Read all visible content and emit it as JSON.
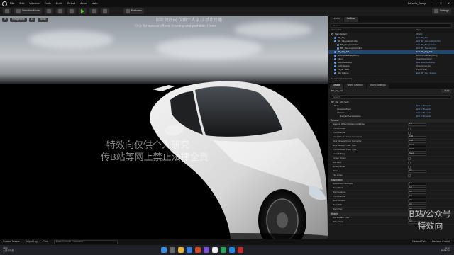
{
  "menubar": {
    "items": [
      "File",
      "Edit",
      "Window",
      "Tools",
      "Build",
      "Select",
      "Actor",
      "Help"
    ],
    "project": "Disable_Jump",
    "window_controls": [
      "—",
      "□",
      "✕"
    ]
  },
  "toolbar": {
    "mode_label": "Selection Mode",
    "platforms_label": "Platforms",
    "settings_label": "Settings"
  },
  "viewport": {
    "perspective_label": "Perspective",
    "lit_label": "Lit",
    "show_label": "Show",
    "watermark_top": "B站:特效向 仅供个人学习 禁止传播",
    "watermark_top2": "Only for special effects learning and prohibited from",
    "watermark_center1": "特效向仅供个人研究",
    "watermark_center2": "传B站等网上禁止法律全责"
  },
  "outliner": {
    "tabs": [
      "Levels",
      "Outliner"
    ],
    "search_placeholder": "Search...",
    "col_label": "Item Label",
    "col_type": "Type",
    "rows": [
      {
        "label": "Main (Editor)",
        "type": "World"
      },
      {
        "label": "BP_Sky",
        "type": "Edit BP_Sky"
      },
      {
        "label": "BP_CinematicConfig",
        "type": "Edit BP_CinematicConfig"
      },
      {
        "label": "BP_BodyController",
        "type": "Edit BP_BodyControl"
      },
      {
        "label": "BP_SteeringController",
        "type": "Edit BP_SteeringCon"
      },
      {
        "label": "BP_Rig_911",
        "type": "Edit BP_Rig_911"
      },
      {
        "label": "ExponentialHeightFog",
        "type": "ExponentialHeightFog"
      },
      {
        "label": "Floor",
        "type": "StaticMeshActor"
      },
      {
        "label": "HDRIBackdrop",
        "type": "Edit HDRIBackdrop"
      },
      {
        "label": "Light Source",
        "type": "DirectionalLight"
      },
      {
        "label": "Player Start",
        "type": "PlayerStart"
      },
      {
        "label": "Sky Sphere",
        "type": "Edit BP_Sky_Sphere"
      }
    ],
    "footer": "13 actors (1 selected)"
  },
  "details": {
    "tabs": [
      "Details",
      "World Partition",
      "World Settings"
    ],
    "actor_name": "BP_Rig_911",
    "add_label": "+ Add",
    "components": [
      {
        "label": "BP_Rig_911 (Self)",
        "type": ""
      },
      {
        "label": "Root",
        "type": "Edit in Blueprint"
      },
      {
        "label": "Camera Mount",
        "type": "Edit in Blueprint"
      },
      {
        "label": "Chassis",
        "type": "Edit in Blueprint"
      },
      {
        "label": "Body and Accessories",
        "type": "Edit in Blueprint"
      }
    ],
    "section_general": "General",
    "props": [
      {
        "label": "Steering Wheel Rotation Multiplier",
        "value": "1.0"
      },
      {
        "label": "Front Wheels",
        "value": ""
      },
      {
        "label": "Front Camber",
        "value": ""
      },
      {
        "label": "Front Wheels Cross Connector",
        "value": "0.96"
      },
      {
        "label": "Rear Wheels Cross Connector",
        "value": "0.96"
      },
      {
        "label": "Rear Wheels Track Type",
        "value": "Stock"
      },
      {
        "label": "Front Wheels Track Type",
        "value": "Stock"
      },
      {
        "label": "Front Editing",
        "value": "None"
      },
      {
        "label": "Center Option",
        "value": ""
      },
      {
        "label": "Use ABS",
        "value": ""
      },
      {
        "label": "Debug Mode",
        "value": ""
      },
      {
        "label": "Brake",
        "value": "0.0"
      },
      {
        "label": "Tire Lights",
        "value": ""
      }
    ],
    "section_suspension": "Suspension",
    "susp_props": [
      {
        "label": "Suspension Stiffness",
        "value": "1.0"
      },
      {
        "label": "Body Pitch",
        "value": "0.0"
      },
      {
        "label": "Body Leaning",
        "value": "0.0"
      },
      {
        "label": "Front Camber",
        "value": "0.0"
      },
      {
        "label": "Rear Camber",
        "value": "0.0"
      },
      {
        "label": "Body Roll",
        "value": "0.0"
      },
      {
        "label": "Body Yaw",
        "value": "0.0"
      }
    ],
    "section_wheels": "Wheels",
    "wheel_props": [
      {
        "label": "Use Default Tires",
        "value": ""
      },
      {
        "label": "Wheel Size",
        "value": "0.0"
      }
    ]
  },
  "statusbar": {
    "items": [
      "Content Drawer",
      "Output Log",
      "Cmd"
    ],
    "cmd_placeholder": "Enter Console Command",
    "right": [
      "Derived Data",
      "Revision Control"
    ]
  },
  "taskbar": {
    "weather_temp": "18°C",
    "weather_text": "大部分晴朗",
    "clock_time": "18:13",
    "clock_date": "2024/1/3"
  },
  "branding": {
    "line1": "B站/公众号",
    "line2": "特效向"
  },
  "colors": {
    "accent": "#21476f",
    "play": "#52c234",
    "viewport_bg": "#000000"
  }
}
